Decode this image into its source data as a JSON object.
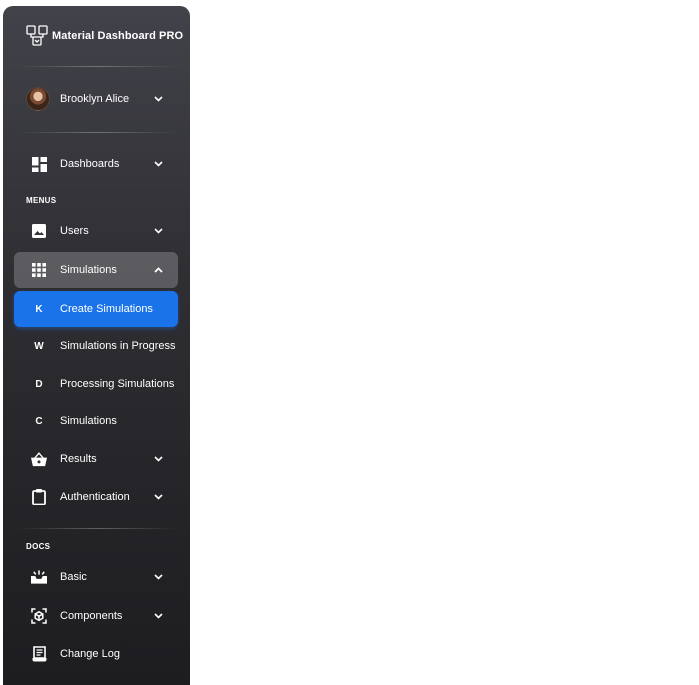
{
  "brand": {
    "title": "Material Dashboard PRO",
    "logo_icon": "logo-icon"
  },
  "user": {
    "name": "Brooklyn Alice",
    "avatar_icon": "avatar-image"
  },
  "nav": {
    "dashboards": {
      "label": "Dashboards",
      "icon": "dashboard-icon"
    },
    "section_menus": "MENUS",
    "users": {
      "label": "Users",
      "icon": "image-icon"
    },
    "simulations": {
      "label": "Simulations",
      "icon": "grid-icon",
      "expanded": true
    },
    "sub_items": [
      {
        "letter": "K",
        "label": "Create Simulations",
        "selected": true
      },
      {
        "letter": "W",
        "label": "Simulations in Progress",
        "selected": false
      },
      {
        "letter": "D",
        "label": "Processing Simulations",
        "selected": false
      },
      {
        "letter": "C",
        "label": "Simulations",
        "selected": false
      }
    ],
    "results": {
      "label": "Results",
      "icon": "basket-icon"
    },
    "authentication": {
      "label": "Authentication",
      "icon": "clipboard-icon"
    },
    "section_docs": "DOCS",
    "basic": {
      "label": "Basic",
      "icon": "upcoming-icon"
    },
    "components": {
      "label": "Components",
      "icon": "view-in-ar-icon"
    },
    "changelog": {
      "label": "Change Log",
      "icon": "receipt-icon"
    }
  },
  "colors": {
    "sidebar_top": "#42424a",
    "sidebar_bottom": "#1d1d20",
    "accent": "#1a73e8"
  }
}
